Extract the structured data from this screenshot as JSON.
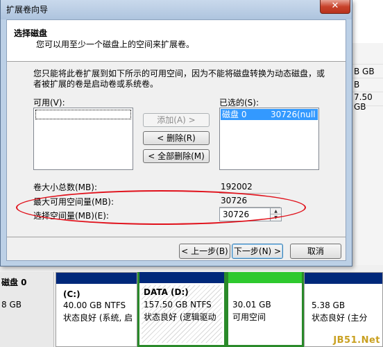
{
  "background": {
    "sizes": [
      "B GB",
      "B",
      "7.50 GB"
    ],
    "disk_label": "磁盘 0",
    "disk_size": "8 GB",
    "partitions": [
      {
        "name": "(C:)",
        "size": "40.00 GB NTFS",
        "status": "状态良好 (系统, 启"
      },
      {
        "name": "DATA  (D:)",
        "size": "157.50 GB NTFS",
        "status": "状态良好 (逻辑驱动"
      },
      {
        "name": "",
        "size": "30.01 GB",
        "status": "可用空间"
      },
      {
        "name": "",
        "size": "5.38 GB",
        "status": "状态良好 (主分"
      }
    ],
    "watermark": "JB51.Net"
  },
  "wizard": {
    "title": "扩展卷向导",
    "close_label": "✕",
    "header_title": "选择磁盘",
    "header_desc": "您可以用至少一个磁盘上的空间来扩展卷。",
    "intro_text": "您只能将此卷扩展到如下所示的可用空间，因为不能将磁盘转换为动态磁盘，或者被扩展的卷是启动卷或系统卷。",
    "available_label": "可用(V):",
    "selected_label": "已选的(S):",
    "selected_items": [
      {
        "disk": "磁盘 0",
        "size": "30726",
        "extra": "(null"
      }
    ],
    "buttons": {
      "add": "添加(A) >",
      "remove": "< 删除(R)",
      "remove_all": "< 全部删除(M)",
      "back": "< 上一步(B)",
      "next": "下一步(N) >",
      "cancel": "取消"
    },
    "fields": {
      "total_label": "卷大小总数(MB):",
      "total_value": "192002",
      "max_label": "最大可用空间量(MB):",
      "max_value": "30726",
      "select_label": "选择空间量(MB)(E):",
      "select_value": "30726"
    }
  },
  "colors": {
    "primary_partition": "#00287a",
    "free_space": "#2ec92e",
    "selection": "#3399ff",
    "annotation": "#e0101a"
  }
}
